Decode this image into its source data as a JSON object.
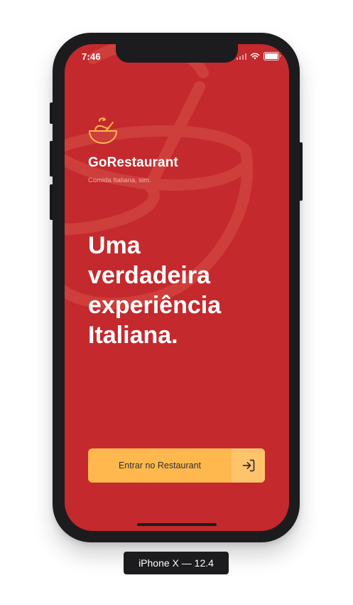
{
  "status_bar": {
    "time": "7:46"
  },
  "app": {
    "brand_name": "GoRestaurant",
    "tagline": "Comida Italiana, sim.",
    "headline_lines": [
      "Uma",
      "verdadeira",
      "experiência",
      "Italiana."
    ],
    "enter_button_label": "Entrar no Restaurant",
    "enter_icon": "log-in-icon",
    "logo_icon": "bowl-icon"
  },
  "device_caption": "iPhone X — 12.4",
  "colors": {
    "background": "#c4292d",
    "accent": "#ffb84d",
    "accent_light": "#ffc46b",
    "button_text": "#312e38",
    "text": "#ffffff"
  }
}
